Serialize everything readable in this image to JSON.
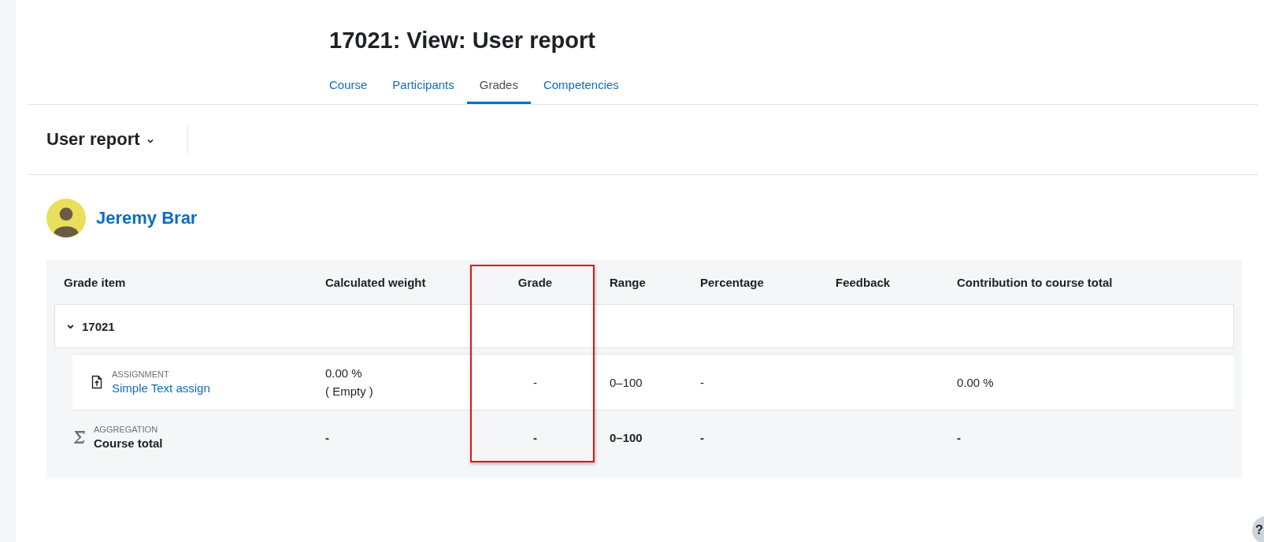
{
  "page_title": "17021: View: User report",
  "tabs": [
    {
      "label": "Course",
      "selected": false
    },
    {
      "label": "Participants",
      "selected": false
    },
    {
      "label": "Grades",
      "selected": true
    },
    {
      "label": "Competencies",
      "selected": false
    }
  ],
  "report_selector": {
    "label": "User report"
  },
  "user": {
    "name": "Jeremy Brar"
  },
  "table": {
    "columns": [
      "Grade item",
      "Calculated weight",
      "Grade",
      "Range",
      "Percentage",
      "Feedback",
      "Contribution to course total"
    ],
    "rows": [
      {
        "kind": "category",
        "name": "17021",
        "expanded": true
      },
      {
        "kind": "item",
        "type_label": "ASSIGNMENT",
        "name": "Simple Text assign",
        "calculated_weight": "0.00 %",
        "weight_note": "( Empty )",
        "grade": "-",
        "range": "0–100",
        "percentage": "-",
        "contribution": "0.00 %"
      },
      {
        "kind": "total",
        "type_label": "AGGREGATION",
        "name": "Course total",
        "calculated_weight": "-",
        "grade": "-",
        "range": "0–100",
        "percentage": "-",
        "contribution": "-"
      }
    ]
  },
  "help_button": {
    "label": "?"
  }
}
